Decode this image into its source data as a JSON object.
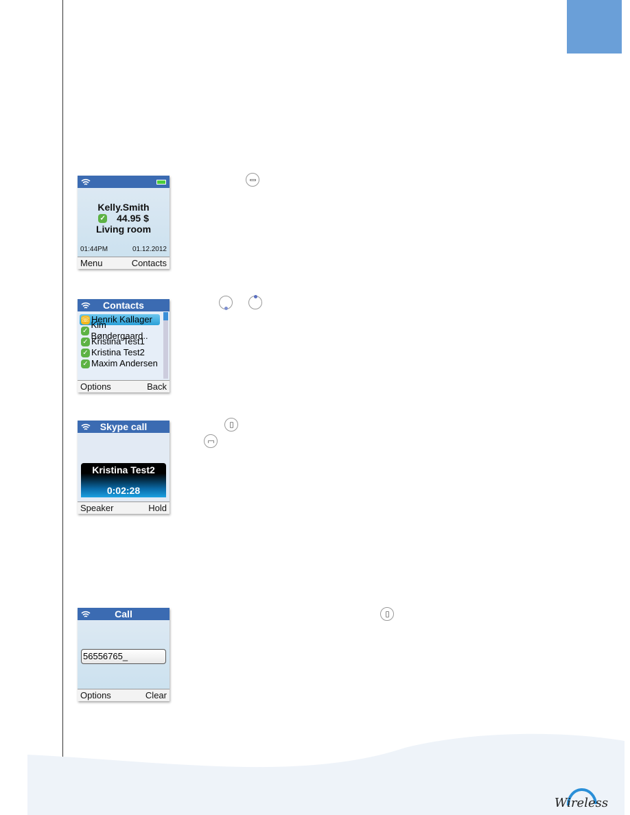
{
  "colors": {
    "accent": "#6a9fd8",
    "header": "#3b6bb2",
    "online": "#5db244"
  },
  "screen1": {
    "name": "Kelly.Smith",
    "credit": "44.95 $",
    "location": "Living room",
    "time": "01:44PM",
    "date": "01.12.2012",
    "soft_left": "Menu",
    "soft_right": "Contacts"
  },
  "screen2": {
    "title": "Contacts",
    "contacts": [
      {
        "name": "Henrik Kallager",
        "status": "away"
      },
      {
        "name": "Kim Bøndergaard..",
        "status": "online"
      },
      {
        "name": "Kristina Test1",
        "status": "online"
      },
      {
        "name": "Kristina Test2",
        "status": "online"
      },
      {
        "name": "Maxim Andersen",
        "status": "online"
      }
    ],
    "soft_left": "Options",
    "soft_right": "Back"
  },
  "screen3": {
    "title": "Skype call",
    "caller": "Kristina Test2",
    "duration": "0:02:28",
    "soft_left": "Speaker",
    "soft_right": "Hold"
  },
  "screen4": {
    "title": "Call",
    "number": "56556765_",
    "soft_left": "Options",
    "soft_right": "Clear"
  },
  "icons": [
    "menu-key-icon",
    "nav-down-icon",
    "nav-up-icon",
    "call-key-icon",
    "end-call-key-icon",
    "call-key-icon"
  ],
  "logo": "Wireless"
}
